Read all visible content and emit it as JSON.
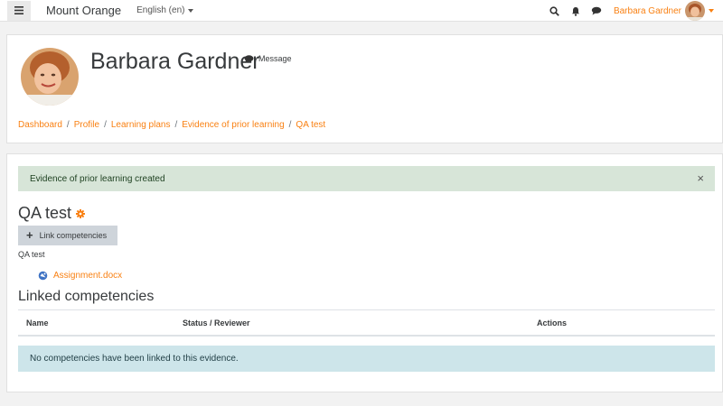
{
  "navbar": {
    "site_name": "Mount Orange",
    "language": "English (en)",
    "user_name": "Barbara Gardner",
    "icons": [
      "hamburger-menu-icon",
      "search-icon",
      "bell-icon",
      "chat-icon"
    ]
  },
  "header": {
    "name": "Barbara Gardner",
    "message_label": "Message",
    "breadcrumb": [
      "Dashboard",
      "Profile",
      "Learning plans",
      "Evidence of prior learning",
      "QA test"
    ]
  },
  "main": {
    "alert": "Evidence of prior learning created",
    "close_glyph": "×",
    "title": "QA test",
    "link_button": "Link competencies",
    "description": "QA test",
    "attachment": "Assignment.docx",
    "section_title": "Linked competencies",
    "table_headers": [
      "Name",
      "Status / Reviewer",
      "Actions"
    ],
    "empty_message": "No competencies have been linked to this evidence."
  },
  "colors": {
    "accent": "#f98012",
    "success_bg": "#d7e5d8",
    "info_bg": "#cde5ea",
    "button_bg": "#ced4da"
  }
}
